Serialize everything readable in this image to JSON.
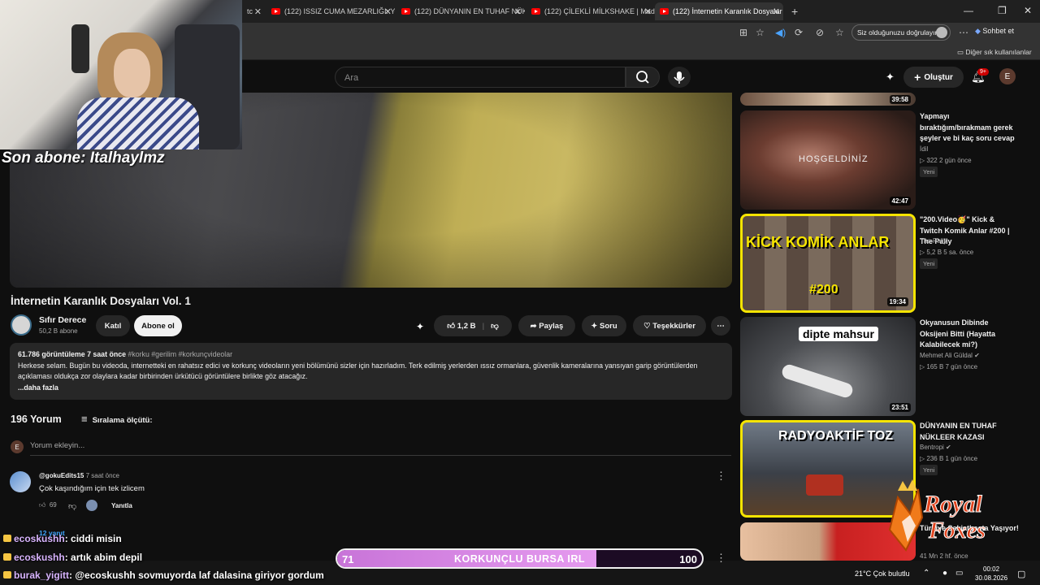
{
  "browser": {
    "tabs": [
      {
        "label": "tc"
      },
      {
        "label": "(122) ISSIZ CUMA MEZARLIĞI: Yer"
      },
      {
        "label": "(122) DÜNYANIN EN TUHAF NÜKL"
      },
      {
        "label": "(122) ÇİLEKLİ MİLKSHAKE | Madar"
      },
      {
        "label": "(122) İnternetin Karanlık Dosyalar"
      }
    ],
    "new_tab": "+",
    "signin_label": "Siz olduğunuzu doğrulayın",
    "copilot_label": "Sohbet et",
    "bookmarks_label": "Diğer sık kullanılanlar"
  },
  "youtube": {
    "search_placeholder": "Ara",
    "create_label": "Oluştur",
    "notif_badge": "9+",
    "avatar_letter": "E"
  },
  "stream": {
    "last_sub": "Son abone: Italhaylmz",
    "chat": [
      {
        "user": "ecoskushh",
        "text": ": ciddi misin"
      },
      {
        "user": "ecoskushh",
        "text": ": artık abim depil"
      },
      {
        "user": "burak_yigitt",
        "text": ": @ecoskushh sovmuyorda laf dalasina giriyor gordum"
      }
    ],
    "goal": {
      "current": "71",
      "label": "KORKUNÇLU BURSA IRL",
      "target": "100",
      "fraction": 0.71
    },
    "logo_text": "Royal Foxes"
  },
  "video": {
    "title": "İnternetin Karanlık Dosyaları Vol. 1",
    "channel": "Sıfır Derece",
    "subs": "50,2 B abone",
    "join": "Katıl",
    "subscribe": "Abone ol",
    "likes": "1,2 B",
    "share": "Paylaş",
    "ask": "Soru",
    "thanks": "Teşekkürler",
    "desc_meta": "61.786 görüntüleme  7 saat önce",
    "desc_tags": "#korku #gerilim #korkunçvideolar",
    "desc_text": "Herkese selam. Bugün bu videoda, internetteki en rahatsız edici ve korkunç videoların yeni bölümünü sizler için hazırladım. Terk edilmiş yerlerden ıssız ormanlara, güvenlik kameralarına yansıyan garip görüntülerden açıklaması oldukça zor olaylara kadar birbirinden ürkütücü görüntülere birlikte göz atacağız.",
    "desc_more": "...daha fazla"
  },
  "comments": {
    "count": "196 Yorum",
    "sort": "Sıralama ölçütü:",
    "add_placeholder": "Yorum ekleyin...",
    "my_initial": "E",
    "items": [
      {
        "author": "@gokuEdits15",
        "time": "7 saat önce",
        "text": "Çok kaşındığım için tek izlicem",
        "likes": "69",
        "reply": "Yanıtla",
        "replies": "12 yanıt"
      }
    ]
  },
  "sidebar": [
    {
      "duration": "39:58"
    },
    {
      "title": "Yapmayı bıraktığım/bırakmam gerek şeyler ve bi kaç soru cevap",
      "channel": "İdil",
      "stats": "▷ 322  2 gün önce",
      "badge": "Yeni",
      "duration": "42:47",
      "thumb_text": "HOŞGELDİNİZ"
    },
    {
      "title": "\"200.Video🥳\" Kick & Twitch Komik Anlar #200 | The Pally",
      "channel": "The Pally",
      "stats": "▷ 5,2 B  5 sa. önce",
      "badge": "Yeni",
      "duration": "19:34",
      "thumb_text": "KİCK KOMİK ANLAR",
      "thumb_text2": "#200"
    },
    {
      "title": "Okyanusun Dibinde Oksijeni Bitti (Hayatta Kalabilecek mi?)",
      "channel": "Mehmet Ali Güldal",
      "stats": "▷ 165 B  7 gün önce",
      "duration": "23:51",
      "thumb_text": "dipte mahsur"
    },
    {
      "title": "DÜNYANIN EN TUHAF NÜKLEER KAZASI",
      "channel": "Bentropi",
      "stats": "▷ 236 B  1 gün önce",
      "badge": "Yeni",
      "duration": "",
      "thumb_text": "RADYOAKTİF TOZ"
    },
    {
      "title": "Türkiye Sakiatbaçta Yaşıyor!",
      "channel": "Beast Gaming",
      "stats": "41 Mn  2 hf. önce"
    }
  ],
  "taskbar": {
    "weather": "21°C  Çok bulutlu",
    "time": "00:02",
    "date": "30.08.2026"
  }
}
